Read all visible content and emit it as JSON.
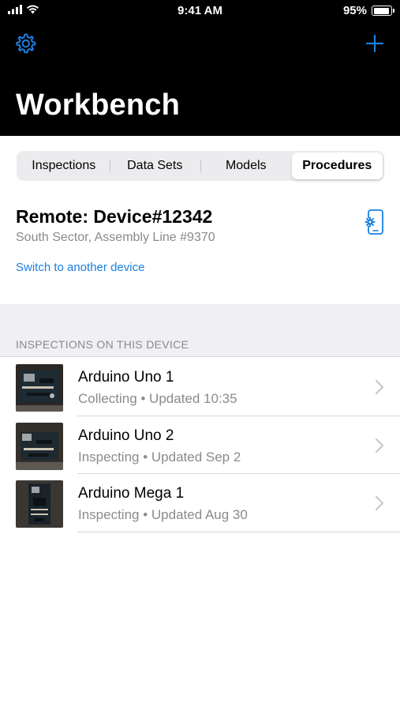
{
  "status_bar": {
    "time": "9:41 AM",
    "battery": "95%",
    "battery_level": 0.95
  },
  "header": {
    "title": "Workbench"
  },
  "tabs": [
    {
      "label": "Inspections",
      "active": false
    },
    {
      "label": "Data Sets",
      "active": false
    },
    {
      "label": "Models",
      "active": false
    },
    {
      "label": "Procedures",
      "active": true
    }
  ],
  "device": {
    "title": "Remote: Device#12342",
    "subtitle": "South Sector, Assembly Line #9370",
    "switch_label": "Switch to another device"
  },
  "section": {
    "header": "INSPECTIONS ON THIS DEVICE"
  },
  "inspections": [
    {
      "title": "Arduino Uno 1",
      "subtitle": "Collecting • Updated 10:35"
    },
    {
      "title": "Arduino Uno 2",
      "subtitle": "Inspecting • Updated Sep 2"
    },
    {
      "title": "Arduino Mega 1",
      "subtitle": "Inspecting • Updated Aug 30"
    }
  ],
  "colors": {
    "accent": "#1b7fe0",
    "header_bg": "#000000",
    "secondary_text": "#8a8a8e"
  },
  "icons": {
    "gear": "gear-icon",
    "add": "plus-icon",
    "device_settings": "device-settings-icon",
    "chevron": "chevron-right-icon",
    "thumbnail": "circuit-board-thumbnail"
  }
}
